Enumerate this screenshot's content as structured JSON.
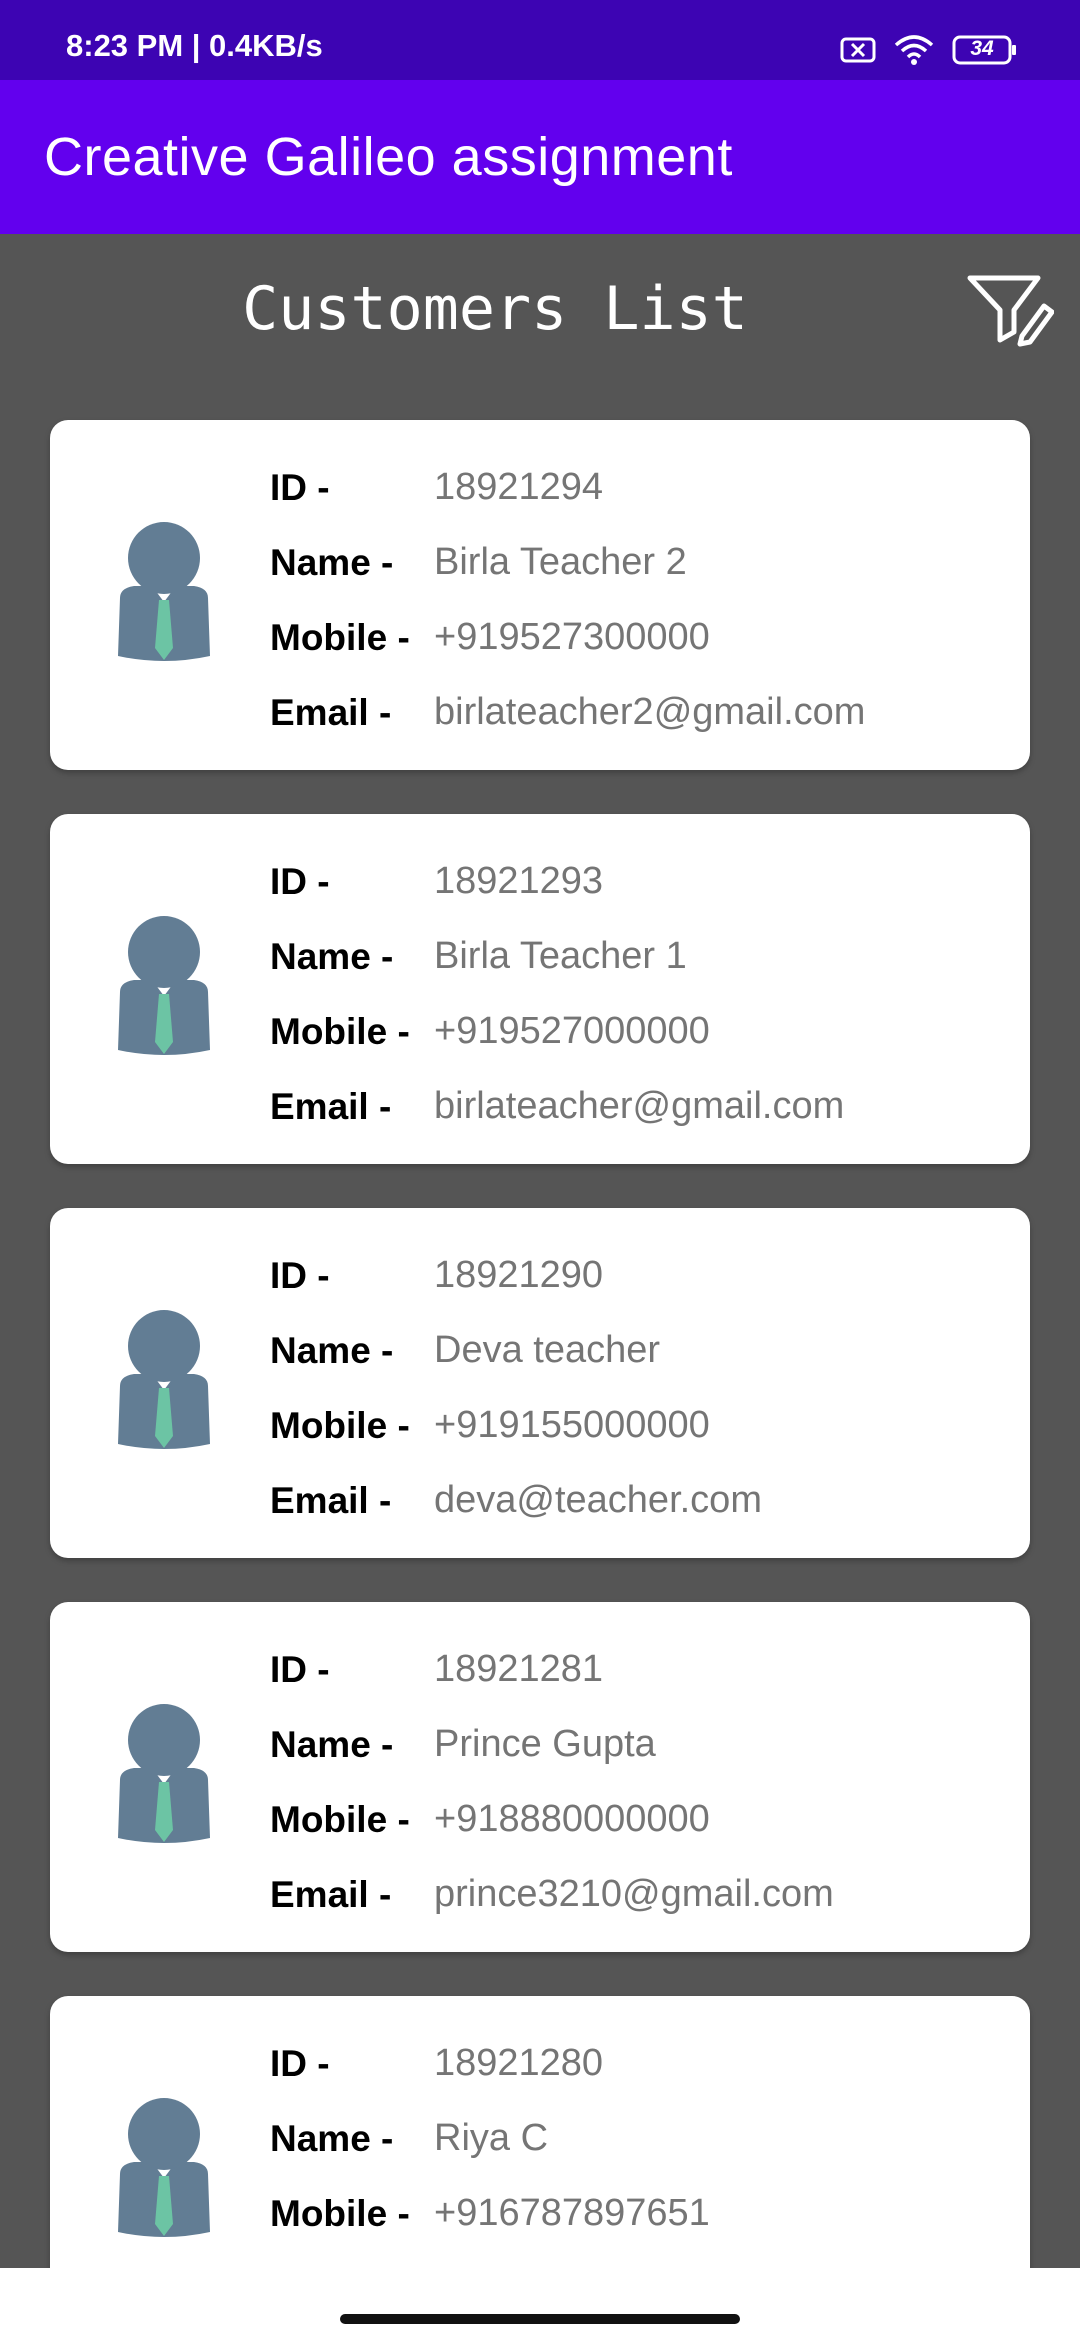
{
  "status_bar": {
    "time": "8:23 PM | 0.4KB/s",
    "battery": "34",
    "icons": [
      "sim-x-icon",
      "wifi-icon",
      "battery-icon"
    ]
  },
  "app_bar": {
    "title": "Creative Galileo assignment",
    "color": "#6200ee"
  },
  "page": {
    "title": "Customers List",
    "filter_icon": "filter-edit-icon",
    "background": "#555555"
  },
  "labels": {
    "id": "ID -",
    "name": "Name -",
    "mobile": "Mobile -",
    "email": "Email -"
  },
  "customers": [
    {
      "id": "18921294",
      "name": "Birla Teacher 2",
      "mobile": "+919527300000",
      "email": "birlateacher2@gmail.com"
    },
    {
      "id": "18921293",
      "name": "Birla Teacher 1",
      "mobile": "+919527000000",
      "email": "birlateacher@gmail.com"
    },
    {
      "id": "18921290",
      "name": "Deva teacher",
      "mobile": "+919155000000",
      "email": "deva@teacher.com"
    },
    {
      "id": "18921281",
      "name": "Prince Gupta",
      "mobile": "+918880000000",
      "email": "prince3210@gmail.com"
    },
    {
      "id": "18921280",
      "name": "Riya C",
      "mobile": "+916787897651",
      "email": ""
    }
  ]
}
